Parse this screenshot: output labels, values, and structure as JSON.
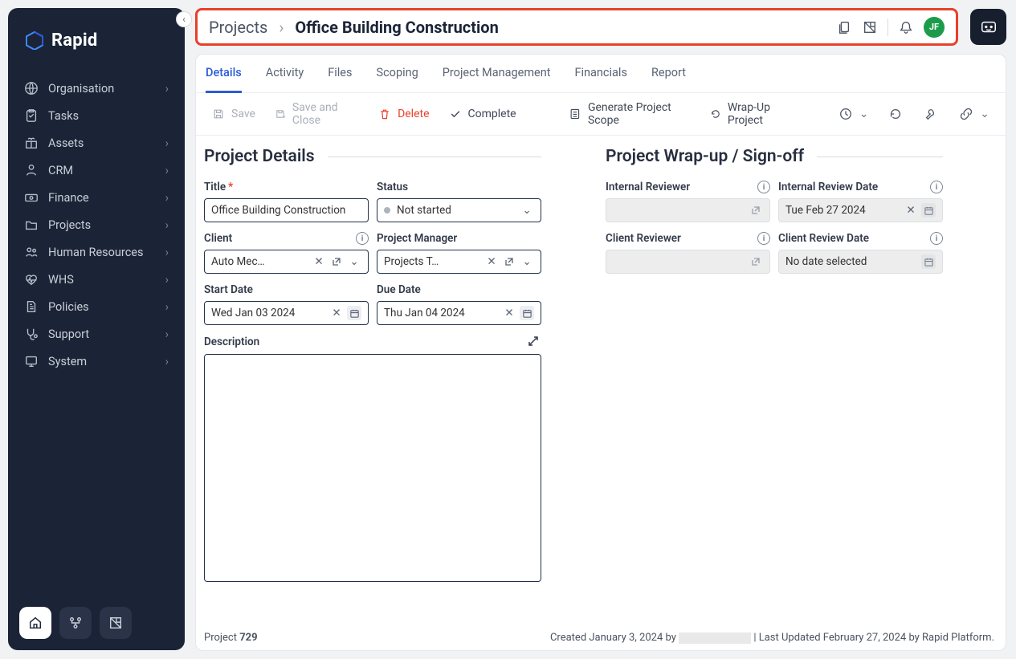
{
  "app": {
    "brand": "Rapid",
    "avatar_initials": "JF"
  },
  "sidebar": {
    "items": [
      {
        "label": "Organisation",
        "icon": "globe-icon"
      },
      {
        "label": "Tasks",
        "icon": "clipboard-icon"
      },
      {
        "label": "Assets",
        "icon": "gift-icon"
      },
      {
        "label": "CRM",
        "icon": "person-icon"
      },
      {
        "label": "Finance",
        "icon": "money-icon"
      },
      {
        "label": "Projects",
        "icon": "folder-icon"
      },
      {
        "label": "Human Resources",
        "icon": "people-icon"
      },
      {
        "label": "WHS",
        "icon": "heartbeat-icon"
      },
      {
        "label": "Policies",
        "icon": "document-icon"
      },
      {
        "label": "Support",
        "icon": "stethoscope-icon"
      },
      {
        "label": "System",
        "icon": "system-icon"
      }
    ]
  },
  "breadcrumb": {
    "parent": "Projects",
    "current": "Office Building Construction"
  },
  "tabs": [
    "Details",
    "Activity",
    "Files",
    "Scoping",
    "Project Management",
    "Financials",
    "Report"
  ],
  "toolbar": {
    "save": "Save",
    "save_close": "Save and Close",
    "delete": "Delete",
    "complete": "Complete",
    "generate_scope": "Generate Project Scope",
    "wrap_up": "Wrap-Up Project"
  },
  "details": {
    "section_title": "Project Details",
    "title_label": "Title",
    "title_value": "Office Building Construction",
    "status_label": "Status",
    "status_value": "Not started",
    "client_label": "Client",
    "client_value": "Auto Mec…",
    "pm_label": "Project Manager",
    "pm_value": "Projects T…",
    "start_label": "Start Date",
    "start_value": "Wed Jan 03 2024",
    "due_label": "Due Date",
    "due_value": "Thu Jan 04 2024",
    "description_label": "Description",
    "description_value": ""
  },
  "wrapup": {
    "section_title": "Project Wrap-up / Sign-off",
    "int_reviewer_label": "Internal Reviewer",
    "int_reviewer_value": "",
    "int_date_label": "Internal Review Date",
    "int_date_value": "Tue Feb 27 2024",
    "cli_reviewer_label": "Client Reviewer",
    "cli_reviewer_value": "",
    "cli_date_label": "Client Review Date",
    "cli_date_value": "No date selected"
  },
  "footer": {
    "project_label": "Project",
    "project_id": "729",
    "created_prefix": "Created January 3, 2024 by",
    "updated": " | Last Updated February 27, 2024 by Rapid Platform."
  }
}
